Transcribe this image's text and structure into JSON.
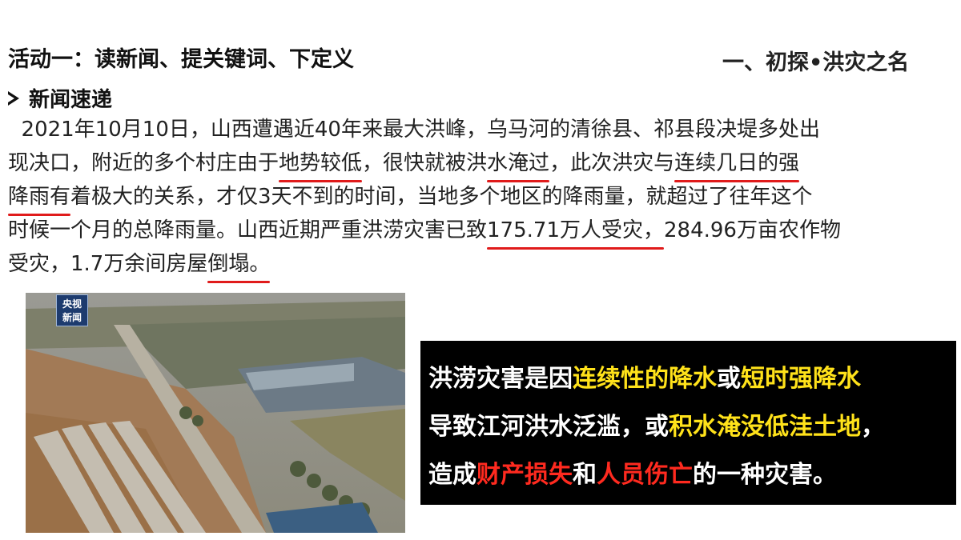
{
  "header": {
    "activity_title": "活动一：读新闻、提关键词、下定义",
    "section_title": "一、初探•洪灾之名"
  },
  "news": {
    "heading": "新闻速递",
    "line1": "  2021年10月10日，山西遭遇近40年来最大洪峰，乌马河的清徐县、祁县段决堤多处出",
    "line2": {
      "a": "现决口，附近的多个村庄由于",
      "u1": "地势较低",
      "b": "，很快就被洪",
      "u2": "水淹过",
      "c": "，此次洪灾与",
      "u3": "连续几日的强"
    },
    "line3": {
      "u1": "降雨有",
      "a": "着极大的关系，才仅3天不到的时间，当地多个地区的降雨量，就超过了往年这个"
    },
    "line4": {
      "a": "时候一个月的总降雨量。山西近期严重洪涝灾害已致",
      "u1": "175.71万人受灾，",
      "b": "284.96万亩农作物"
    },
    "line5": {
      "a": "受灾，1.7万余间房屋",
      "u1": "倒塌。"
    }
  },
  "photo": {
    "logo_line1": "央视",
    "logo_line2": "新闻"
  },
  "definition": {
    "l1a": "洪涝灾害是因",
    "l1b": "连续性的降水",
    "l1c": "或",
    "l1d": "短时强降水",
    "l2a": "导致江河洪水泛滥，或",
    "l2b": "积水淹没低洼土地",
    "l2c": "，",
    "l3a": "造成",
    "l3b": "财产损失",
    "l3c": "和",
    "l3d": "人员伤亡",
    "l3e": "的一种灾害。"
  },
  "colors": {
    "underline": "#e01b1b",
    "highlight_yellow": "#ffe21a",
    "highlight_red": "#ff2a1f",
    "box_bg": "#000000"
  }
}
